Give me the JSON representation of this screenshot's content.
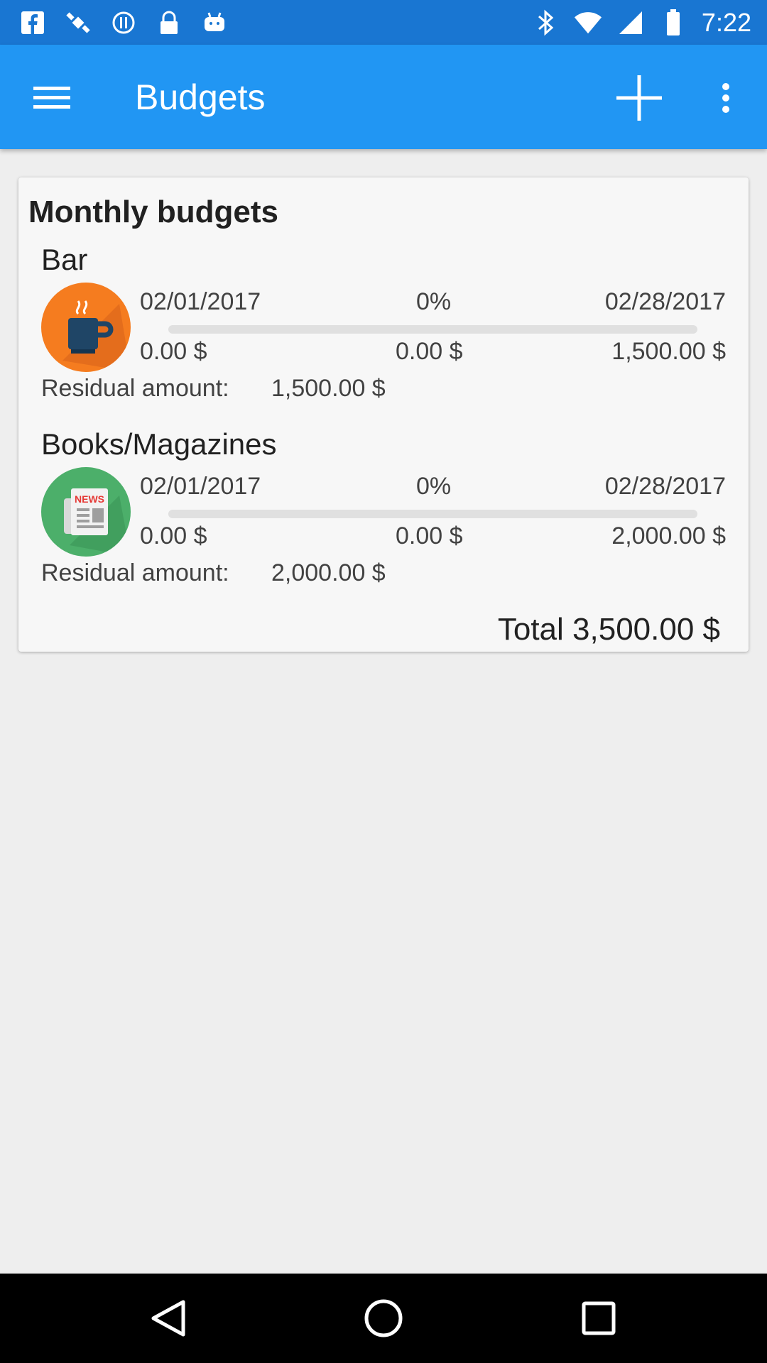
{
  "status_bar": {
    "time": "7:22",
    "left_icons": [
      "facebook-icon",
      "satellite-icon",
      "sync-icon",
      "lock-icon",
      "android-icon"
    ],
    "right_icons": [
      "bluetooth-icon",
      "wifi-icon",
      "signal-icon",
      "battery-icon"
    ]
  },
  "app_bar": {
    "title": "Budgets",
    "menu_icon": "hamburger-menu-icon",
    "add_icon": "plus-icon",
    "more_icon": "more-vertical-icon",
    "background": "#2196f3"
  },
  "card": {
    "title": "Monthly budgets",
    "budgets": [
      {
        "name": "Bar",
        "icon": "coffee-cup-icon",
        "icon_color": "#f57c1f",
        "start_date": "02/01/2017",
        "percent": "0%",
        "progress_fraction": 0,
        "end_date": "02/28/2017",
        "spent": "0.00 $",
        "middle_amount": "0.00 $",
        "budget_amount": "1,500.00 $",
        "residual_label": "Residual amount:",
        "residual_value": "1,500.00 $"
      },
      {
        "name": "Books/Magazines",
        "icon": "newspaper-icon",
        "icon_color": "#4caf6a",
        "start_date": "02/01/2017",
        "percent": "0%",
        "progress_fraction": 0,
        "end_date": "02/28/2017",
        "spent": "0.00 $",
        "middle_amount": "0.00 $",
        "budget_amount": "2,000.00 $",
        "residual_label": "Residual amount:",
        "residual_value": "2,000.00 $",
        "icon_text": "NEWS"
      }
    ],
    "total": "Total 3,500.00 $"
  },
  "nav_bar": {
    "back_icon": "back-triangle-icon",
    "home_icon": "home-circle-icon",
    "recents_icon": "recents-square-icon"
  }
}
